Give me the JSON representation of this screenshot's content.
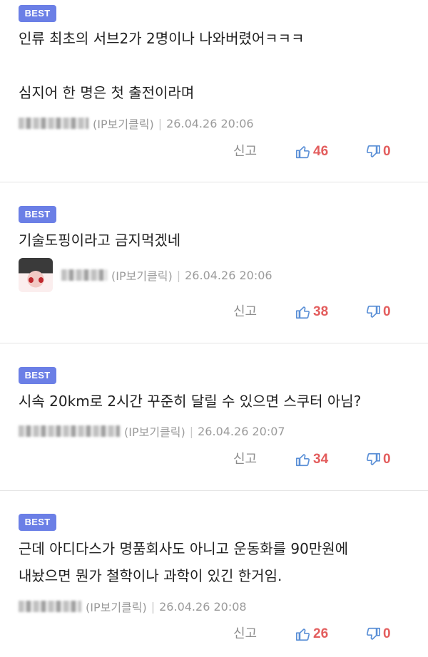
{
  "colors": {
    "badge": "#6b7fe6",
    "count": "#e35d5d",
    "thumb": "#5a8fd6"
  },
  "comments": [
    {
      "badge": "BEST",
      "text": "인류 최초의 서브2가 2명이나 나와버렸어ㅋㅋㅋ\n\n심지어 한 명은 첫 출전이라며",
      "ip": "(IP보기클릭)",
      "sep": "|",
      "date": "26.04.26 20:06",
      "report": "신고",
      "likes": "46",
      "dislikes": "0"
    },
    {
      "badge": "BEST",
      "text": "기술도핑이라고 금지먹겠네",
      "ip": "(IP보기클릭)",
      "sep": "|",
      "date": "26.04.26 20:06",
      "report": "신고",
      "likes": "38",
      "dislikes": "0"
    },
    {
      "badge": "BEST",
      "text": "시속 20km로 2시간 꾸준히 달릴 수 있으면 스쿠터 아님?",
      "ip": "(IP보기클릭)",
      "sep": "|",
      "date": "26.04.26 20:07",
      "report": "신고",
      "likes": "34",
      "dislikes": "0"
    },
    {
      "badge": "BEST",
      "text": "근데 아디다스가 명품회사도 아니고 운동화를 90만원에\n내놨으면 뭔가 철학이나 과학이 있긴 한거임.",
      "ip": "(IP보기클릭)",
      "sep": "|",
      "date": "26.04.26 20:08",
      "report": "신고",
      "likes": "26",
      "dislikes": "0"
    }
  ]
}
